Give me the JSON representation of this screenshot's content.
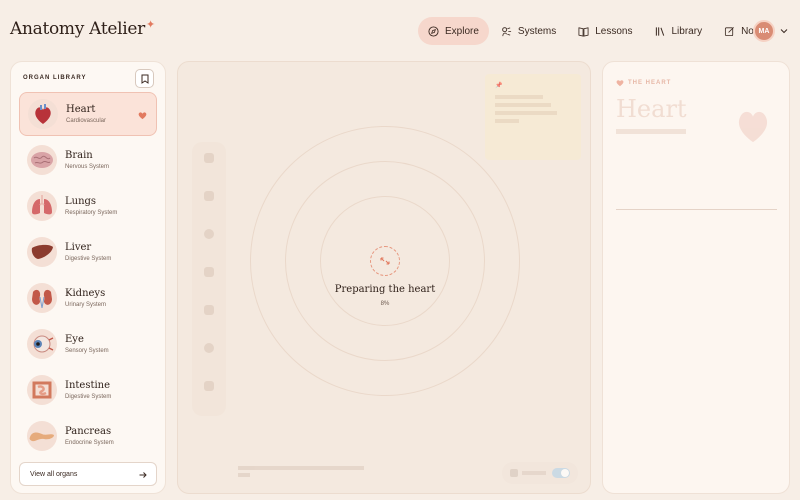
{
  "app": {
    "title": "Anatomy Atelier",
    "accent": "#e27a5f"
  },
  "nav": {
    "items": [
      {
        "label": "Explore",
        "icon": "compass-icon",
        "active": true
      },
      {
        "label": "Systems",
        "icon": "systems-icon"
      },
      {
        "label": "Lessons",
        "icon": "book-icon"
      },
      {
        "label": "Library",
        "icon": "library-icon"
      },
      {
        "label": "Notes",
        "icon": "notes-icon"
      }
    ],
    "avatar_initials": "MA"
  },
  "library": {
    "heading": "ORGAN LIBRARY",
    "organs": [
      {
        "name": "Heart",
        "system": "Cardiovascular",
        "selected": true,
        "favorite": true
      },
      {
        "name": "Brain",
        "system": "Nervous System"
      },
      {
        "name": "Lungs",
        "system": "Respiratory System"
      },
      {
        "name": "Liver",
        "system": "Digestive System"
      },
      {
        "name": "Kidneys",
        "system": "Urinary System"
      },
      {
        "name": "Eye",
        "system": "Sensory System"
      },
      {
        "name": "Intestine",
        "system": "Digestive System"
      },
      {
        "name": "Pancreas",
        "system": "Endocrine System"
      }
    ],
    "view_all_label": "View all organs"
  },
  "viewer": {
    "loading_title": "Preparing the heart",
    "progress": {
      "percent_label": "8%",
      "value": 0.08
    }
  },
  "details": {
    "eyebrow": "THE HEART",
    "title": "Heart"
  }
}
